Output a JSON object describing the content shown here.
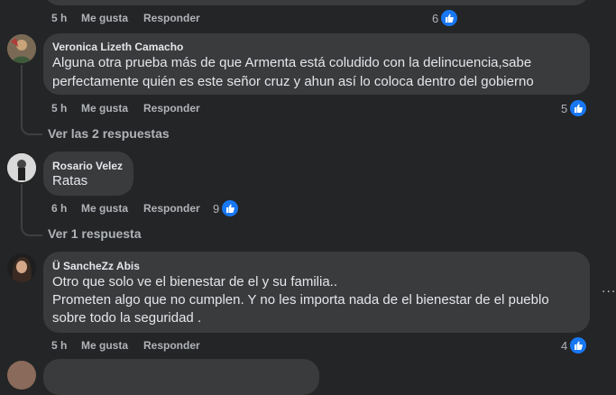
{
  "comments": [
    {
      "time": "5 h",
      "like_label": "Me gusta",
      "reply_label": "Responder",
      "reaction_count": "6"
    },
    {
      "author": "Veronica Lizeth Camacho",
      "lines": [
        "Alguna otra prueba más de que Armenta está coludido con la delincuencia,sabe",
        "perfectamente quién es este señor cruz y ahun así lo coloca dentro del gobierno"
      ],
      "time": "5 h",
      "like_label": "Me gusta",
      "reply_label": "Responder",
      "reaction_count": "5",
      "replies_link": "Ver las 2 respuestas"
    },
    {
      "author": "Rosario Velez",
      "lines": [
        "Ratas"
      ],
      "time": "6 h",
      "like_label": "Me gusta",
      "reply_label": "Responder",
      "reaction_count": "9",
      "replies_link": "Ver 1 respuesta"
    },
    {
      "author": "Ü SancheZz Abis",
      "lines": [
        "Otro que solo ve el bienestar de el y su familia..",
        "Prometen algo que no cumplen. Y no les importa nada de el bienestar de el pueblo",
        "sobre todo la seguridad ."
      ],
      "time": "5 h",
      "like_label": "Me gusta",
      "reply_label": "Responder",
      "reaction_count": "4",
      "more_options": "..."
    }
  ],
  "colors": {
    "background": "#242526",
    "bubble": "#3a3b3c",
    "like_blue": "#1877f2",
    "secondary_text": "#b0b3b8"
  }
}
